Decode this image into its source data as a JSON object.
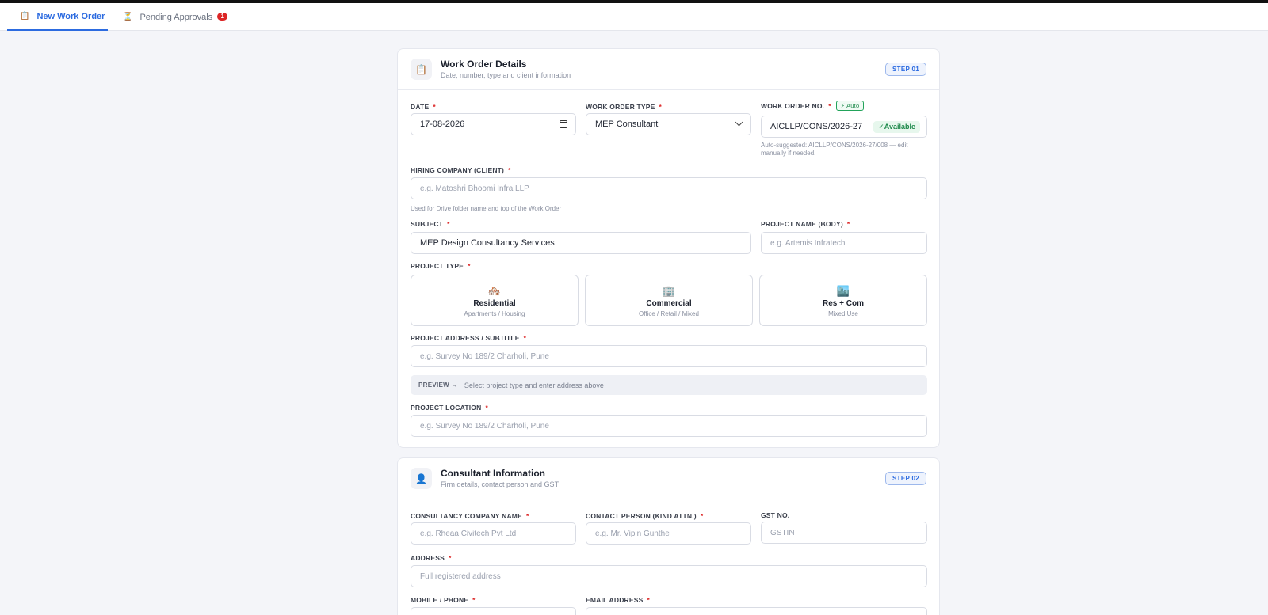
{
  "tabs": [
    {
      "label": "New Work Order",
      "icon": "clipboard-icon"
    },
    {
      "label": "Pending Approvals",
      "icon": "hourglass-icon",
      "badge": "1"
    }
  ],
  "section1": {
    "title": "Work Order Details",
    "subtitle": "Date, number, type and client information",
    "step": "STEP 01",
    "date_label": "DATE",
    "date_value": "17-08-2026",
    "wo_type_label": "WORK ORDER TYPE",
    "wo_type_value": "MEP Consultant",
    "wo_no_label": "WORK ORDER NO.",
    "auto_badge": "⚡ Auto",
    "wo_no_value": "AICLLP/CONS/2026-27",
    "available": "✓Available",
    "wo_no_help": "Auto-suggested: AICLLP/CONS/2026-27/008 — edit manually if needed.",
    "client_label": "HIRING COMPANY (CLIENT)",
    "client_placeholder": "e.g. Matoshri Bhoomi Infra LLP",
    "client_help": "Used for Drive folder name and top of the Work Order",
    "subject_label": "SUBJECT",
    "subject_value": "MEP Design Consultancy Services",
    "project_name_label": "PROJECT NAME (BODY)",
    "project_name_placeholder": "e.g. Artemis Infratech",
    "project_type_label": "PROJECT TYPE",
    "project_types": [
      {
        "name": "Residential",
        "sub": "Apartments / Housing",
        "icon": "🏘️"
      },
      {
        "name": "Commercial",
        "sub": "Office / Retail / Mixed",
        "icon": "🏢"
      },
      {
        "name": "Res + Com",
        "sub": "Mixed Use",
        "icon": "🏙️"
      }
    ],
    "address_label": "PROJECT ADDRESS / SUBTITLE",
    "address_placeholder": "e.g. Survey No 189/2 Charholi, Pune",
    "preview_label": "PREVIEW →",
    "preview_text": "Select project type and enter address above",
    "location_label": "PROJECT LOCATION",
    "location_placeholder": "e.g. Survey No 189/2 Charholi, Pune"
  },
  "section2": {
    "title": "Consultant Information",
    "subtitle": "Firm details, contact person and GST",
    "step": "STEP 02",
    "company_label": "CONSULTANCY COMPANY NAME",
    "company_placeholder": "e.g. Rheaa Civitech Pvt Ltd",
    "contact_label": "CONTACT PERSON (KIND ATTN.)",
    "contact_placeholder": "e.g. Mr. Vipin Gunthe",
    "gst_label": "GST NO.",
    "gst_placeholder": "GSTIN",
    "address_label": "ADDRESS",
    "address_placeholder": "Full registered address",
    "mobile_label": "MOBILE / PHONE",
    "email_label": "EMAIL ADDRESS"
  },
  "required_mark": "*"
}
